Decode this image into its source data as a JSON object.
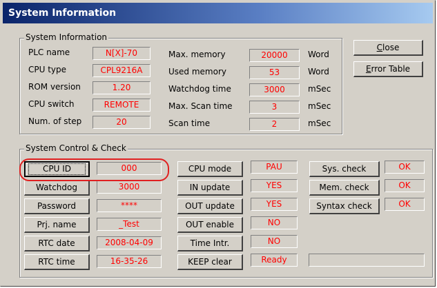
{
  "window": {
    "title": "System Information"
  },
  "system_info": {
    "group_title": "System Information",
    "left_rows": [
      {
        "label": "PLC name",
        "value": "N[X]-70"
      },
      {
        "label": "CPU type",
        "value": "CPL9216A"
      },
      {
        "label": "ROM version",
        "value": "1.20"
      },
      {
        "label": "CPU switch",
        "value": "REMOTE"
      },
      {
        "label": "Num. of step",
        "value": "20"
      }
    ],
    "right_rows": [
      {
        "label": "Max. memory",
        "value": "20000",
        "unit": "Word"
      },
      {
        "label": "Used memory",
        "value": "53",
        "unit": "Word"
      },
      {
        "label": "Watchdog time",
        "value": "3000",
        "unit": "mSec"
      },
      {
        "label": "Max. Scan time",
        "value": "3",
        "unit": "mSec"
      },
      {
        "label": "Scan time",
        "value": "2",
        "unit": "mSec"
      }
    ]
  },
  "buttons": {
    "close_prefix": "C",
    "close_rest": "lose",
    "error_prefix": "E",
    "error_rest": "rror Table"
  },
  "control": {
    "group_title": "System Control & Check",
    "left_rows": [
      {
        "label": "CPU ID",
        "value": "000"
      },
      {
        "label": "Watchdog",
        "value": "3000"
      },
      {
        "label": "Password",
        "value": "****"
      },
      {
        "label": "Prj. name",
        "value": "_Test"
      },
      {
        "label": "RTC date",
        "value": "2008-04-09"
      },
      {
        "label": "RTC time",
        "value": "16-35-26"
      }
    ],
    "mid_rows": [
      {
        "label": "CPU mode",
        "value": "PAU"
      },
      {
        "label": "IN update",
        "value": "YES"
      },
      {
        "label": "OUT update",
        "value": "YES"
      },
      {
        "label": "OUT enable",
        "value": "NO"
      },
      {
        "label": "Time Intr.",
        "value": "NO"
      },
      {
        "label": "KEEP clear",
        "value": "Ready"
      }
    ],
    "right_rows": [
      {
        "label": "Sys. check",
        "value": "OK"
      },
      {
        "label": "Mem. check",
        "value": "OK"
      },
      {
        "label": "Syntax check",
        "value": "OK"
      }
    ],
    "empty_field": ""
  },
  "colors": {
    "value_text": "#ff0000",
    "highlight": "#e02020",
    "title_bar": "#0a246a"
  }
}
